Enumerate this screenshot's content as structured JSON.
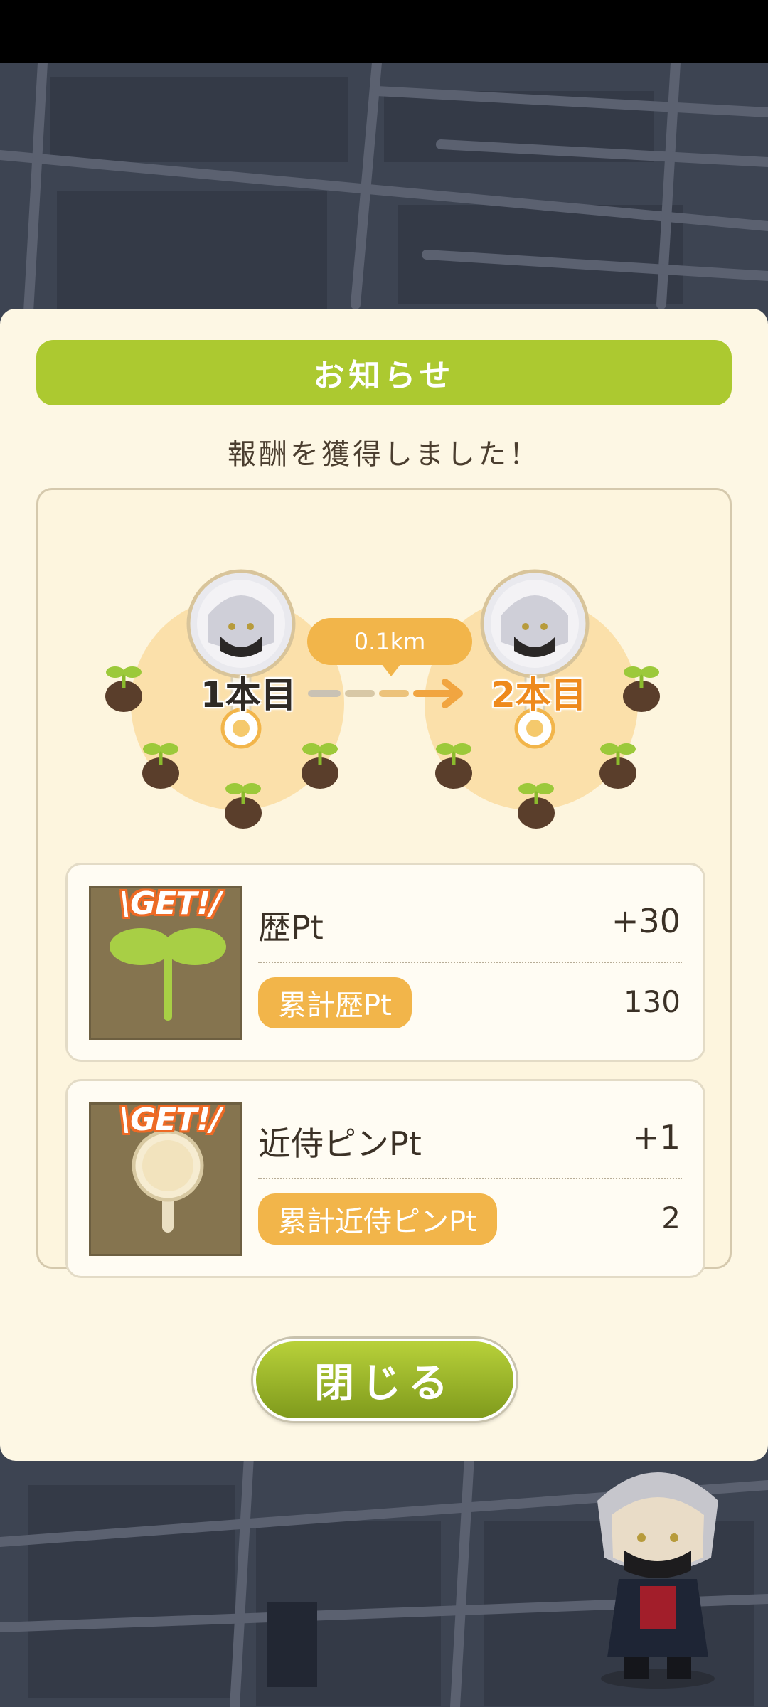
{
  "dialog": {
    "title": "お知らせ",
    "subtitle": "報酬を獲得しました！",
    "close_label": "閉じる"
  },
  "route": {
    "distance": "0.1km",
    "from_label": "1本目",
    "to_label": "2本目"
  },
  "rewards": [
    {
      "badge": "\\GET!/",
      "icon": "sprout-icon",
      "name": "歴Pt",
      "value": "+30",
      "total_label": "累計歴Pt",
      "total_value": "130"
    },
    {
      "badge": "\\GET!/",
      "icon": "pin-icon",
      "name": "近侍ピンPt",
      "value": "+1",
      "total_label": "累計近侍ピンPt",
      "total_value": "2"
    }
  ],
  "colors": {
    "title_bar": "#acc930",
    "badge": "#f2b54a",
    "accent_orange": "#ee8a1c",
    "dialog_bg": "#fdf7e4"
  }
}
